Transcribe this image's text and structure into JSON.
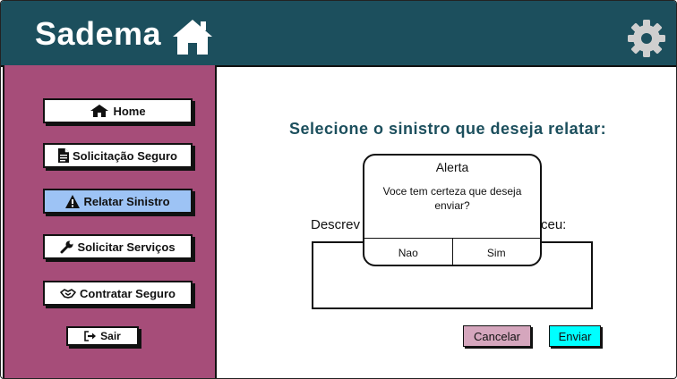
{
  "header": {
    "brand": "Sadema",
    "icons": {
      "brand": "home-icon",
      "settings": "gear-icon"
    }
  },
  "sidebar": {
    "items": [
      {
        "label": "Home",
        "icon": "home-icon",
        "active": false
      },
      {
        "label": "Solicitação Seguro",
        "icon": "document-icon",
        "active": false
      },
      {
        "label": "Relatar Sinistro",
        "icon": "warning-icon",
        "active": true
      },
      {
        "label": "Solicitar Serviços",
        "icon": "wrench-icon",
        "active": false
      },
      {
        "label": "Contratar Seguro",
        "icon": "handshake-icon",
        "active": false
      }
    ],
    "logout": {
      "label": "Sair",
      "icon": "logout-icon"
    }
  },
  "main": {
    "prompt": "Selecione o sinistro que deseja relatar:",
    "description_label_start": "Descrev",
    "description_label_end": "ceu:",
    "description_value": "",
    "cancel_label": "Cancelar",
    "send_label": "Enviar"
  },
  "dialog": {
    "title": "Alerta",
    "message": "Voce tem certeza que deseja enviar?",
    "no_label": "Nao",
    "yes_label": "Sim"
  },
  "colors": {
    "header": "#1c4f5d",
    "sidebar": "#a64d79",
    "active_item": "#9dc3f5",
    "cancel_button": "#d5a6bd",
    "send_button": "#00ffff",
    "prompt_text": "#1c4f5d"
  }
}
